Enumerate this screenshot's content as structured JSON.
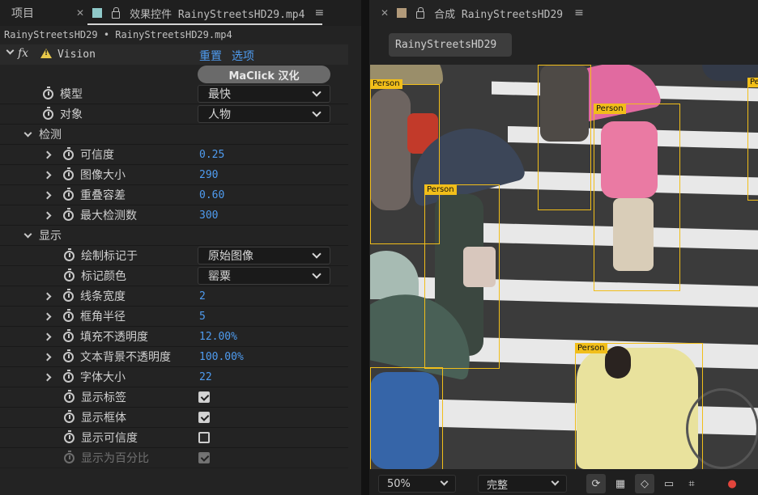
{
  "left_tabs": {
    "project": "项目",
    "effects": "效果控件 RainyStreetsHD29.mp4"
  },
  "breadcrumb": "RainyStreetsHD29 • RainyStreetsHD29.mp4",
  "effect": {
    "name": "Vision",
    "reset": "重置",
    "options": "选项",
    "button": "MaClick 汉化"
  },
  "params": {
    "model_label": "模型",
    "model_value": "最快",
    "target_label": "对象",
    "target_value": "人物",
    "detect_group": "检测",
    "confidence_label": "可信度",
    "confidence_value": "0.25",
    "image_size_label": "图像大小",
    "image_size_value": "290",
    "overlap_label": "重叠容差",
    "overlap_value": "0.60",
    "max_detect_label": "最大检测数",
    "max_detect_value": "300",
    "display_group": "显示",
    "draw_on_label": "绘制标记于",
    "draw_on_value": "原始图像",
    "mark_color_label": "标记颜色",
    "mark_color_value": "罂粟",
    "line_width_label": "线条宽度",
    "line_width_value": "2",
    "corner_radius_label": "框角半径",
    "corner_radius_value": "5",
    "fill_opacity_label": "填充不透明度",
    "fill_opacity_value": "12.00%",
    "text_bg_opacity_label": "文本背景不透明度",
    "text_bg_opacity_value": "100.00%",
    "font_size_label": "字体大小",
    "font_size_value": "22",
    "show_label_label": "显示标签",
    "show_label_checked": true,
    "show_box_label": "显示框体",
    "show_box_checked": true,
    "show_conf_label": "显示可信度",
    "show_conf_checked": false,
    "show_percent_label": "显示为百分比",
    "show_percent_checked": true
  },
  "right_tab": {
    "title": "合成 RainyStreetsHD29"
  },
  "comp_name": "RainyStreetsHD29",
  "detections": {
    "label": "Person",
    "color": "#f1be1a"
  },
  "bottom": {
    "zoom": "50%",
    "resolution": "完整"
  },
  "colors": {
    "link": "#4f9cf0",
    "box": "#f1be1a",
    "swatch_left": "#8fc9c9",
    "swatch_right": "#b29a7a"
  }
}
